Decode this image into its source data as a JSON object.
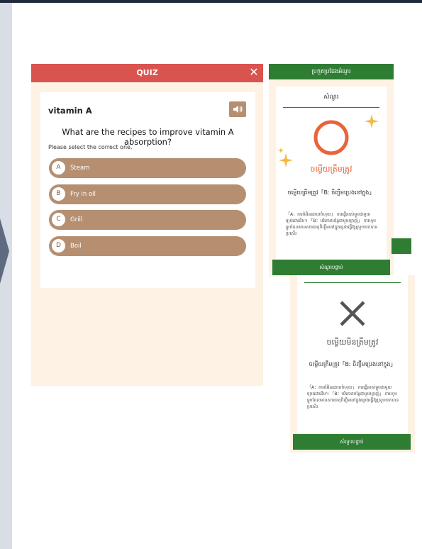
{
  "quiz": {
    "title": "QUIZ",
    "close_icon": "close-icon",
    "topic": "vitamin A",
    "sound_icon": "speaker-icon",
    "question": "What are the recipes to improve vitamin A absorption?",
    "instruction": "Please select the correct one.",
    "options": [
      {
        "letter": "A",
        "text": "Steam"
      },
      {
        "letter": "B",
        "text": "Fry in oil"
      },
      {
        "letter": "C",
        "text": "Grill"
      },
      {
        "letter": "D",
        "text": "Boil"
      }
    ]
  },
  "correct_card": {
    "header": "ប្រកួតប្រជែងអំណួរ",
    "label": "សំណួរ",
    "icon": "circle-correct-icon",
    "verdict": "ចម្លើយត្រឹមត្រូវ",
    "answer": "ចម្លើយត្រឹមត្រូវ「Bː ចិញ្ចឹមប្រេងនៅក្នុង」",
    "explanation": "「A：ការចំអិនដោយចំហុយ」 ការធ្វើរបស់ម្ហូបជាមួយប្រេងជាដើម។ 「B：បរិភោគបន្លែជាមួយខ្លាញ់」 ការហូបម្ហូបដែលមានសារធាតុចិញ្ចឹមនៅក្នុងប្រេងធ្វើឱ្យស្រូបយកបានប្រសើរ",
    "next_label": "សំណួរបន្ទាប់"
  },
  "wrong_card": {
    "icon": "cross-wrong-icon",
    "verdict": "ចម្លើយមិនត្រឹមត្រូវ",
    "answer": "ចម្លើយត្រឹមត្រូវ「Bː ចិញ្ចឹមប្រេងនៅក្នុង」",
    "explanation": "「A：ការចំអិនដោយចំហុយ」 ការធ្វើរបស់ម្ហូបជាមួយប្រេងជាដើម។ 「B：បរិភោគបន្លែជាមួយខ្លាញ់」 ការហូបម្ហូបដែលមានសារធាតុចិញ្ចឹមនៅក្នុងប្រេងធ្វើឱ្យស្រូបយកបានប្រសើរ",
    "next_label": "សំណួរបន្ទាប់"
  },
  "colors": {
    "quiz_header": "#d9534f",
    "option_bg": "#b68f71",
    "result_header": "#2e7d32",
    "correct_circle": "#e8643c",
    "sparkle": "#f5b940",
    "panel_bg": "#fdf2e4"
  }
}
